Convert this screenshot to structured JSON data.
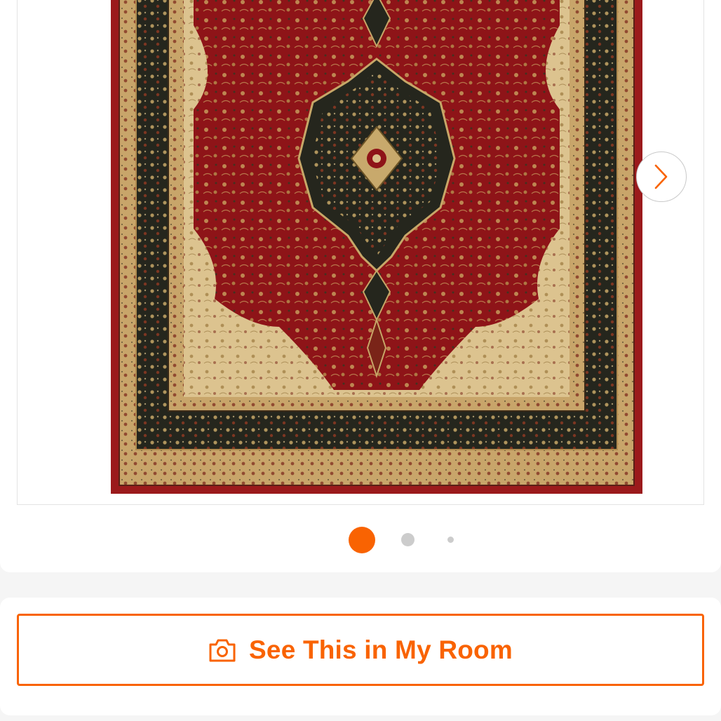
{
  "colors": {
    "accent": "#f96302",
    "dot_inactive": "#cccccc",
    "rug_red": "#8e1418",
    "rug_cream": "#d9c08b",
    "rug_dark": "#23231c"
  },
  "gallery": {
    "image_alt": "Red traditional medallion area rug",
    "next_icon": "chevron-right-icon",
    "total_images": 3,
    "active_index": 1
  },
  "actions": {
    "room_button_label": "See This in My Room",
    "room_button_icon": "camera-icon"
  }
}
